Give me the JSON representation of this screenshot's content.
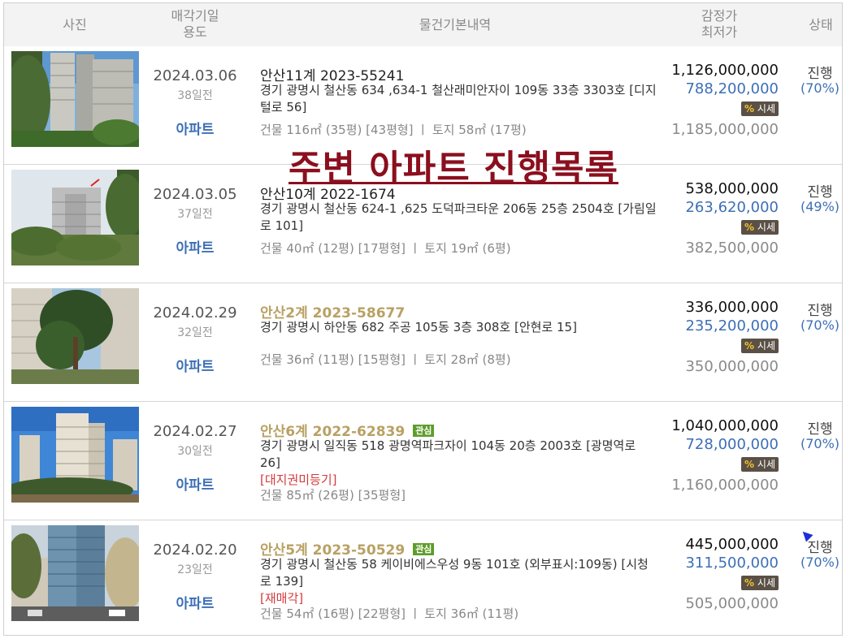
{
  "header": {
    "photo": "사진",
    "date_line1": "매각기일",
    "date_line2": "용도",
    "info": "물건기본내역",
    "price_line1": "감정가",
    "price_line2": "최저가",
    "status": "상태"
  },
  "overlay_title": "주변 아파트 진행목록",
  "market_label": "시세",
  "market_percent": "%",
  "rows": [
    {
      "date": "2024.03.06",
      "ago": "38일전",
      "usage": "아파트",
      "case": "안산11계 2023-55241",
      "tag": "",
      "address": "경기 광명시 철산동 634 ,634-1 철산래미안자이 109동 33층 3303호 [디지털로 56]",
      "special": "",
      "area": "건물 116㎡ (35평) [43평형]  ㅣ  토지 58㎡ (17평)",
      "appraisal": "1,126,000,000",
      "minimum": "788,200,000",
      "market_price": "1,185,000,000",
      "status": "진행",
      "ratio": "(70%)"
    },
    {
      "date": "2024.03.05",
      "ago": "37일전",
      "usage": "아파트",
      "case": "안산10계 2022-1674",
      "tag": "",
      "address": "경기 광명시 철산동 624-1 ,625 도덕파크타운 206동 25층 2504호 [가림일로 101]",
      "special": "",
      "area": "건물 40㎡ (12평) [17평형]  ㅣ  토지 19㎡ (6평)",
      "appraisal": "538,000,000",
      "minimum": "263,620,000",
      "market_price": "382,500,000",
      "status": "진행",
      "ratio": "(49%)"
    },
    {
      "date": "2024.02.29",
      "ago": "32일전",
      "usage": "아파트",
      "case": "안산2계 2023-58677",
      "tag": "",
      "address": "경기 광명시 하안동 682 주공 105동 3층 308호 [안현로 15]",
      "special": "",
      "area": "건물 36㎡ (11평) [15평형]  ㅣ  토지 28㎡ (8평)",
      "appraisal": "336,000,000",
      "minimum": "235,200,000",
      "market_price": "350,000,000",
      "status": "진행",
      "ratio": "(70%)"
    },
    {
      "date": "2024.02.27",
      "ago": "30일전",
      "usage": "아파트",
      "case": "안산6계 2022-62839",
      "tag": "관심",
      "address": "경기 광명시 일직동 518 광명역파크자이 104동 20층 2003호 [광명역로 26]",
      "special": "[대지권미등기]",
      "area": "건물 85㎡ (26평) [35평형]",
      "appraisal": "1,040,000,000",
      "minimum": "728,000,000",
      "market_price": "1,160,000,000",
      "status": "진행",
      "ratio": "(70%)"
    },
    {
      "date": "2024.02.20",
      "ago": "23일전",
      "usage": "아파트",
      "case": "안산5계 2023-50529",
      "tag": "관심",
      "address": "경기 광명시 철산동 58 케이비에스우성 9동 101호 (외부표시:109동) [시청로 139]",
      "special": "[재매각]",
      "area": "건물 54㎡ (16평) [22평형]  ㅣ  토지 36㎡ (11평)",
      "appraisal": "445,000,000",
      "minimum": "311,500,000",
      "market_price": "505,000,000",
      "status": "진행",
      "ratio": "(70%)"
    }
  ]
}
